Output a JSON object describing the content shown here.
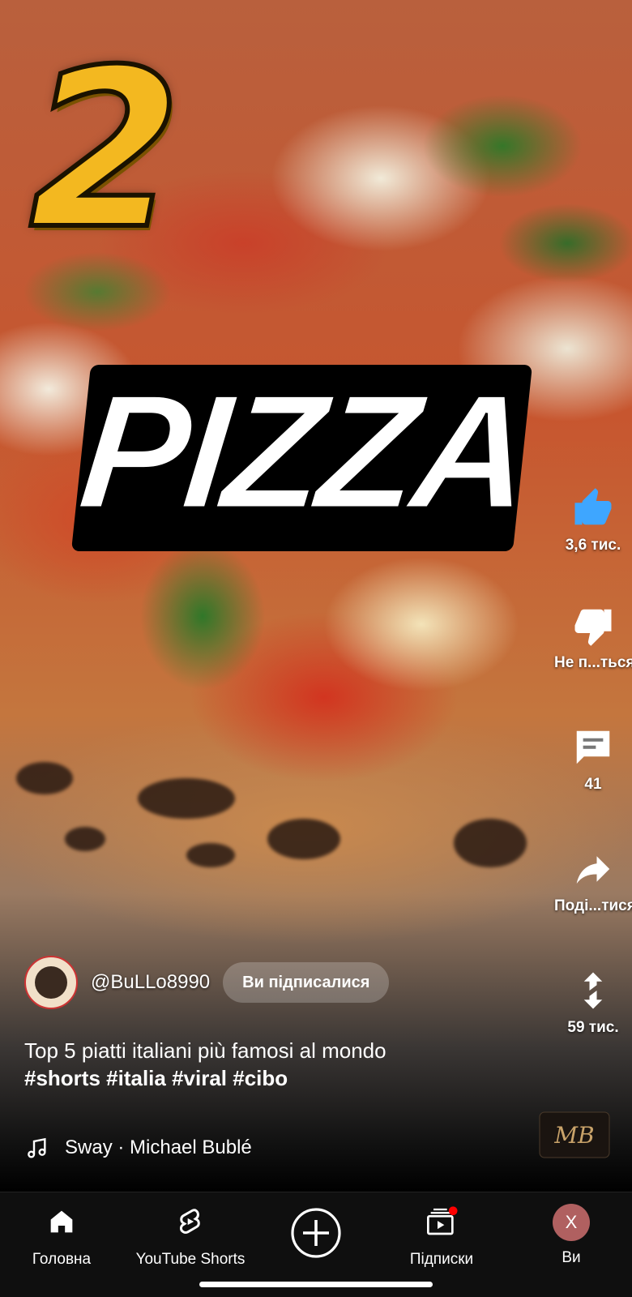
{
  "overlay": {
    "number": "2",
    "word": "PIZZA"
  },
  "actions": {
    "like": {
      "label": "3,6 тис.",
      "icon": "thumb-up-icon"
    },
    "dislike": {
      "label": "Не п...ться",
      "icon": "thumb-down-icon"
    },
    "comments": {
      "label": "41",
      "icon": "comment-icon"
    },
    "share": {
      "label": "Поді...тися",
      "icon": "share-icon"
    },
    "remix": {
      "label": "59 тис.",
      "icon": "remix-icon"
    }
  },
  "channel": {
    "handle": "@BuLLo8990",
    "subscribe_label": "Ви підписалися"
  },
  "video": {
    "title": "Top 5 piatti italiani più famosi al mondo",
    "hashtags": "#shorts #italia #viral #cibo"
  },
  "music": {
    "track": "Sway · Michael Bublé",
    "disc_text": "MB"
  },
  "nav": {
    "home": "Головна",
    "shorts": "YouTube Shorts",
    "create": "",
    "subscriptions": "Підписки",
    "you": "Ви",
    "avatar_letter": "X"
  },
  "colors": {
    "like_accent": "#3ea6ff",
    "badge": "#ff0000",
    "number_gold": "#f3b820"
  }
}
